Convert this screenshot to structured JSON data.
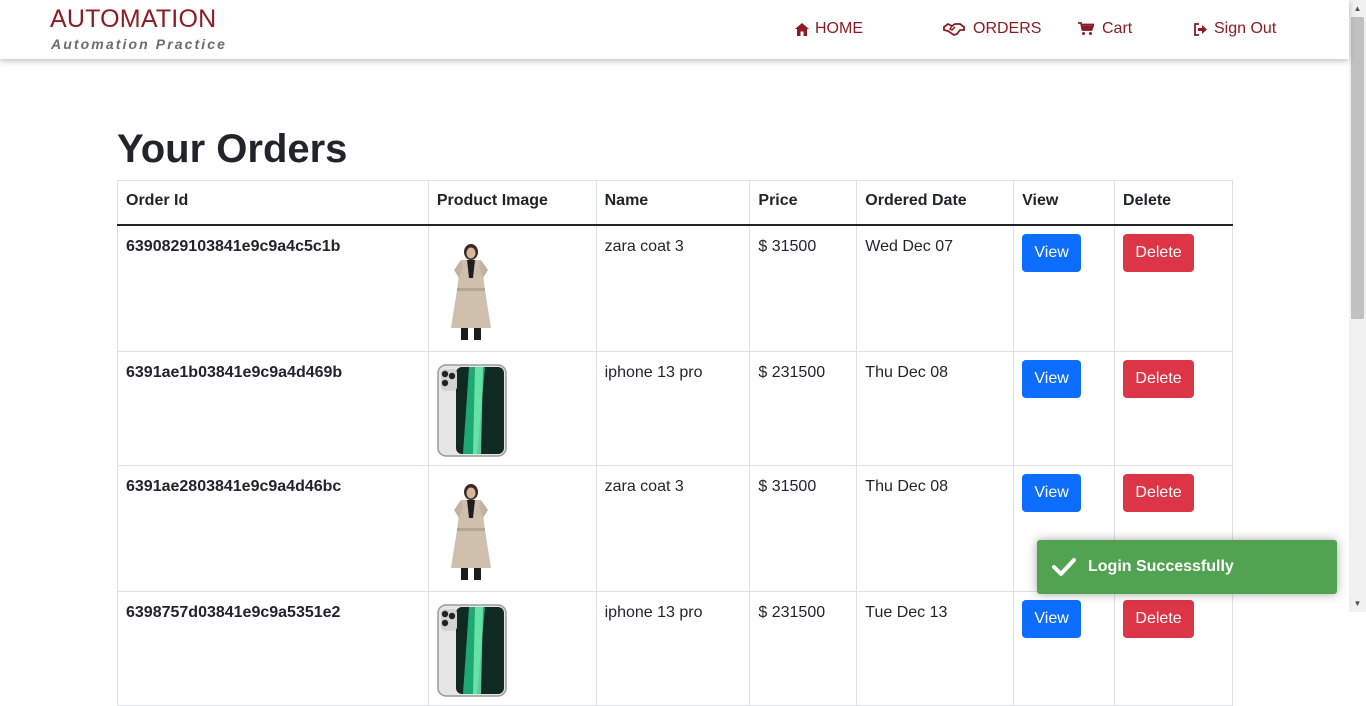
{
  "brand": {
    "title": "AUTOMATION",
    "subtitle": "Automation Practice"
  },
  "nav": [
    {
      "label": "HOME",
      "icon": "home-icon"
    },
    {
      "label": "ORDERS",
      "icon": "handshake-icon"
    },
    {
      "label": "Cart",
      "icon": "cart-icon"
    },
    {
      "label": "Sign Out",
      "icon": "sign-out-icon"
    }
  ],
  "page": {
    "title": "Your Orders"
  },
  "table": {
    "headers": [
      "Order Id",
      "Product Image",
      "Name",
      "Price",
      "Ordered Date",
      "View",
      "Delete"
    ],
    "rows": [
      {
        "id": "6390829103841e9c9a4c5c1b",
        "name": "zara coat 3",
        "price": "$ 31500",
        "date": "Wed Dec 07",
        "image": "zara-coat-image",
        "view": "View",
        "delete": "Delete"
      },
      {
        "id": "6391ae1b03841e9c9a4d469b",
        "name": "iphone 13 pro",
        "price": "$ 231500",
        "date": "Thu Dec 08",
        "image": "iphone-image",
        "view": "View",
        "delete": "Delete"
      },
      {
        "id": "6391ae2803841e9c9a4d46bc",
        "name": "zara coat 3",
        "price": "$ 31500",
        "date": "Thu Dec 08",
        "image": "zara-coat-image",
        "view": "View",
        "delete": "Delete"
      },
      {
        "id": "6398757d03841e9c9a5351e2",
        "name": "iphone 13 pro",
        "price": "$ 231500",
        "date": "Tue Dec 13",
        "image": "iphone-image",
        "view": "View",
        "delete": "Delete"
      }
    ]
  },
  "toast": {
    "message": "Login Successfully",
    "icon": "check-icon"
  },
  "colors": {
    "brand": "#8b1c24",
    "view_button": "#0d6efd",
    "delete_button": "#dc3545",
    "toast": "#51a351"
  }
}
